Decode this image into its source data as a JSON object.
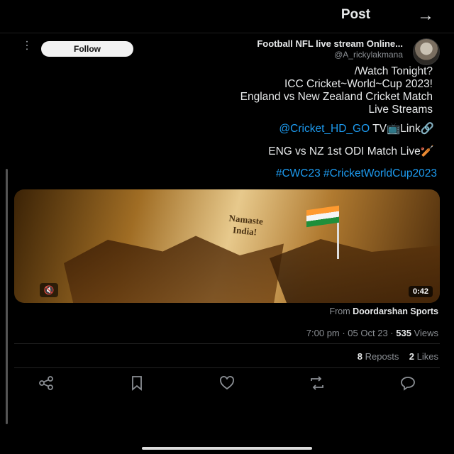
{
  "header": {
    "title": "Post",
    "back_icon": "arrow-icon"
  },
  "author": {
    "name": "Football NFL live stream Online...",
    "handle": "@A_rickylakmana",
    "follow_label": "Follow",
    "more_icon": "more-icon"
  },
  "post": {
    "lines": [
      "/Watch  Tonight?",
      "ICC Cricket~World~Cup 2023!",
      "England vs New Zealand Cricket Match",
      "Live Streams"
    ],
    "tv_label": "TV📺Link🔗",
    "tv_link": "@Cricket_HD_GO",
    "match_line": "ENG vs NZ 1st ODI Match Live🏏",
    "hashtags": "#CWC23  #CricketWorldCup2023"
  },
  "media": {
    "duration": "0:42",
    "mute_icon": "mute-icon",
    "sign_line1": "Namaste",
    "sign_line2": "India!"
  },
  "source": {
    "prefix": "From",
    "name": "Doordarshan Sports"
  },
  "meta": {
    "time": "7:00 pm · 05 Oct 23 · ",
    "views_count": "535",
    "views_label": " Views"
  },
  "stats": {
    "reposts_count": "8",
    "reposts_label": " Reposts",
    "likes_count": "2",
    "likes_label": " Likes"
  },
  "actions": [
    "share-icon",
    "bookmark-icon",
    "heart-icon",
    "repost-icon",
    "reply-icon"
  ]
}
